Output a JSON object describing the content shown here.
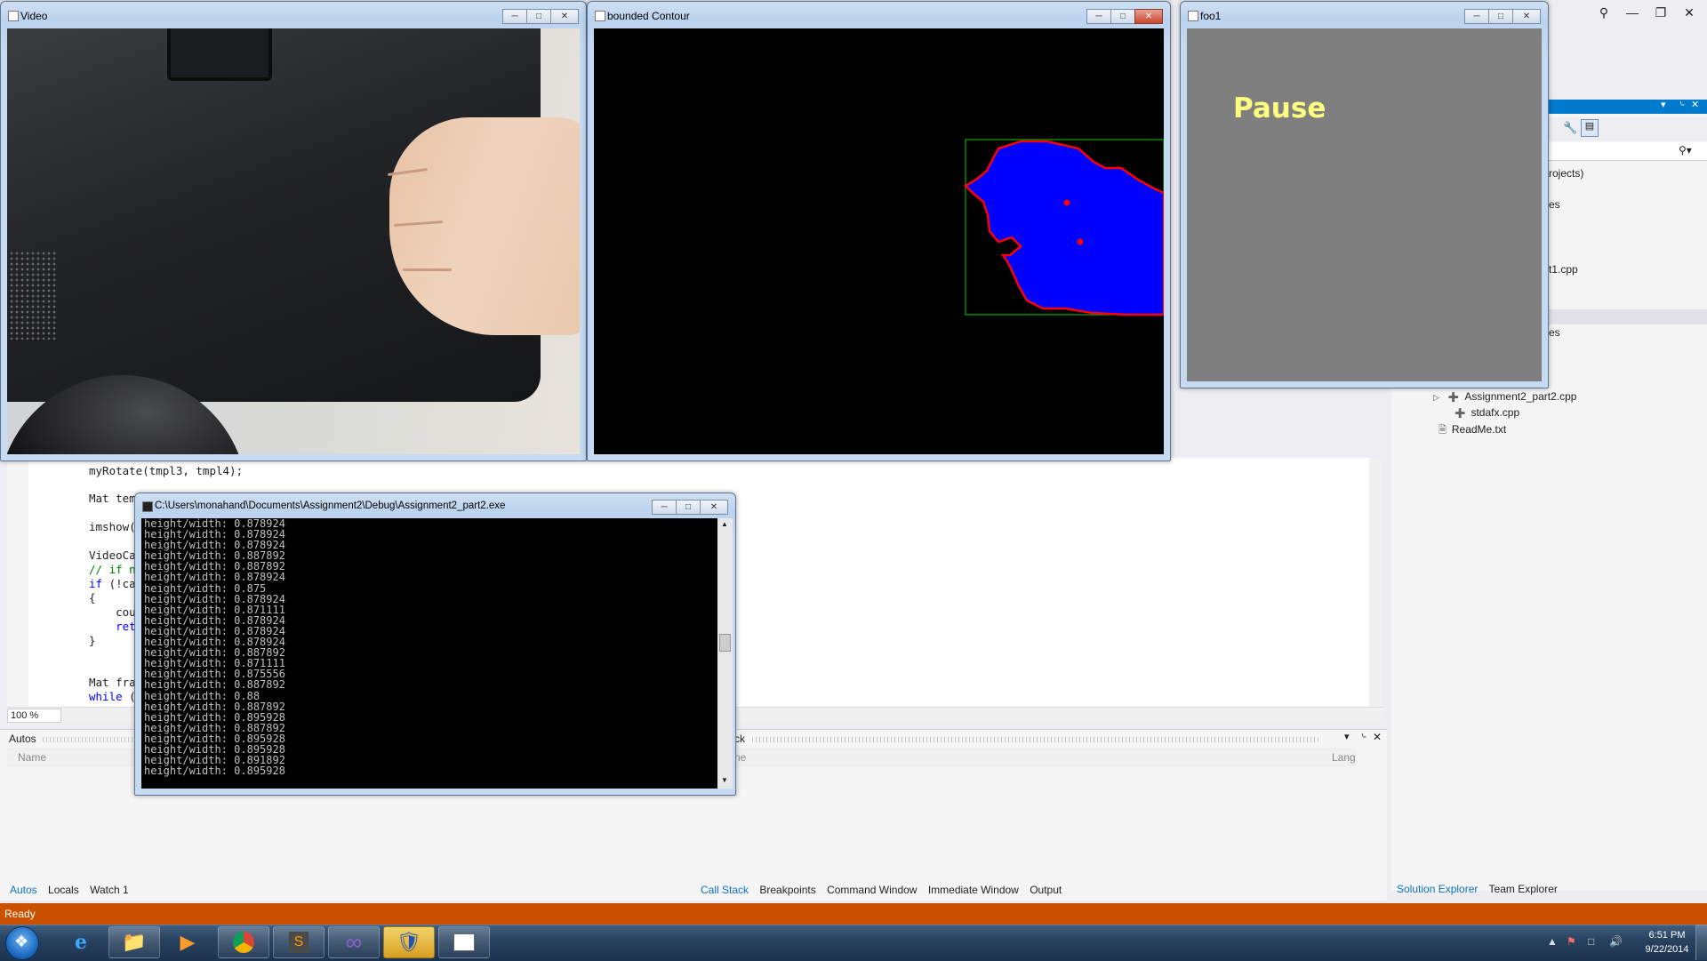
{
  "status_bar": {
    "text": "Ready"
  },
  "editor": {
    "zoom": "100 %",
    "lines": [
      {
        "text": "myRotate(tmpl3, tmpl4);",
        "kind": "plain"
      },
      {
        "text": "Mat tem",
        "kind": "plain"
      },
      {
        "text": "imshow(",
        "kind": "plain"
      },
      {
        "text": "VideoCap",
        "kind": "plain"
      },
      {
        "text": "// if no",
        "kind": "comment"
      },
      {
        "text": "if (!cap",
        "kind": "keyword"
      },
      {
        "text": "{",
        "kind": "plain"
      },
      {
        "text": "    cou",
        "kind": "plain"
      },
      {
        "text": "    retu",
        "kind": "keyword"
      },
      {
        "text": "}",
        "kind": "plain"
      },
      {
        "text": "Mat fran",
        "kind": "plain"
      },
      {
        "text": "while (t",
        "kind": "keyword"
      }
    ]
  },
  "solution_explorer": {
    "partial_texts": [
      "rojects)",
      "es",
      "t1.cpp",
      "es"
    ],
    "files": [
      "Assignment2_part2.cpp",
      "stdafx.cpp",
      "ReadMe.txt"
    ],
    "tabs": [
      "Solution Explorer",
      "Team Explorer"
    ],
    "active_tab": "Solution Explorer"
  },
  "autos_panel": {
    "title": "Autos",
    "column_name": "Name",
    "tabs": [
      "Autos",
      "Locals",
      "Watch 1"
    ],
    "active_tab": "Autos"
  },
  "callstack_panel": {
    "title_fragment": "ck",
    "column_name_fragment": "ne",
    "column_lang_fragment": "Lang",
    "tabs": [
      "Call Stack",
      "Breakpoints",
      "Command Window",
      "Immediate Window",
      "Output"
    ],
    "active_tab": "Call Stack"
  },
  "windows": {
    "video": {
      "title": "Video"
    },
    "contour": {
      "title": "bounded Contour"
    },
    "foo": {
      "title": "foo1",
      "overlay_text": "Pause"
    },
    "console": {
      "title": "C:\\Users\\monahand\\Documents\\Assignment2\\Debug\\Assignment2_part2.exe",
      "lines": [
        "height/width: 0.878924",
        "height/width: 0.878924",
        "height/width: 0.878924",
        "height/width: 0.887892",
        "height/width: 0.887892",
        "height/width: 0.878924",
        "height/width: 0.875",
        "height/width: 0.878924",
        "height/width: 0.871111",
        "height/width: 0.878924",
        "height/width: 0.878924",
        "height/width: 0.878924",
        "height/width: 0.887892",
        "height/width: 0.871111",
        "height/width: 0.875556",
        "height/width: 0.887892",
        "height/width: 0.88",
        "height/width: 0.887892",
        "height/width: 0.895928",
        "height/width: 0.887892",
        "height/width: 0.895928",
        "height/width: 0.895928",
        "height/width: 0.891892",
        "height/width: 0.895928"
      ]
    }
  },
  "taskbar": {
    "apps": [
      "internet-explorer",
      "file-explorer",
      "media-player",
      "chrome",
      "sublime-text",
      "visual-studio",
      "security-shield",
      "console-app"
    ],
    "clock": {
      "time": "6:51 PM",
      "date": "9/22/2014"
    }
  },
  "colors": {
    "status_bar": "#ca5100",
    "vs_accent": "#007acc",
    "contour_fill": "#0000ff",
    "contour_outline": "#ff0000",
    "bounding_box": "#00b000",
    "pause_text": "#ffff80",
    "foo_background": "#7f7f7f"
  }
}
